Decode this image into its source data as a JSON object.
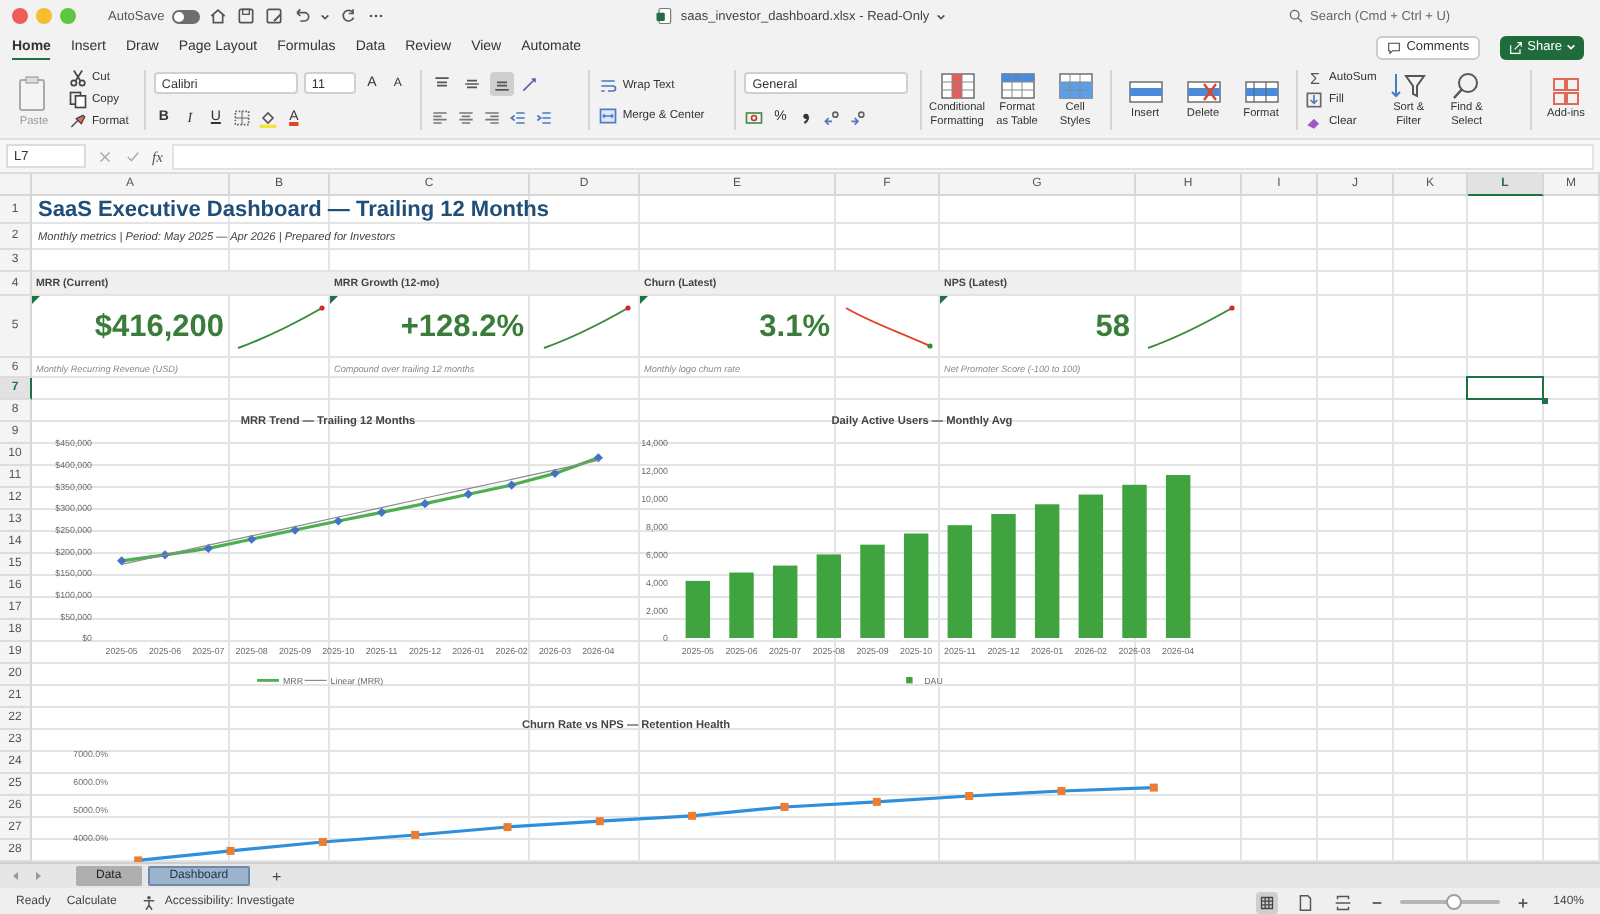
{
  "window": {
    "title": "saas_investor_dashboard.xlsx - Read-Only",
    "autosave_label": "AutoSave",
    "autosave_on": false,
    "search": {
      "placeholder": "Search (Cmd + Ctrl + U)"
    }
  },
  "ribbon_tabs": [
    {
      "label": "Home",
      "selected": true
    },
    {
      "label": "Insert",
      "selected": false
    },
    {
      "label": "Draw",
      "selected": false
    },
    {
      "label": "Page Layout",
      "selected": false
    },
    {
      "label": "Formulas",
      "selected": false
    },
    {
      "label": "Data",
      "selected": false
    },
    {
      "label": "Review",
      "selected": false
    },
    {
      "label": "View",
      "selected": false
    },
    {
      "label": "Automate",
      "selected": false
    }
  ],
  "comments_button": "Comments",
  "share_button": "Share",
  "ribbon": {
    "clipboard": {
      "paste": "Paste",
      "cut": "Cut",
      "copy": "Copy",
      "format": "Format"
    },
    "font": {
      "name": "Calibri",
      "size": "11",
      "grow": "A",
      "shrink": "A",
      "bold": "B",
      "italic": "I",
      "underline": "U",
      "tint": "A"
    },
    "vertical_align": [
      {
        "kind": "top",
        "selected": false
      },
      {
        "kind": "middle",
        "selected": false
      },
      {
        "kind": "bottom",
        "selected": true
      }
    ],
    "wrap_text": "Wrap Text",
    "merge": "Merge & Center",
    "number": {
      "format": "General",
      "percent": "%"
    },
    "styles": [
      {
        "kind": "conditional",
        "label": "Conditional\nFormatting"
      },
      {
        "kind": "table",
        "label": "Format\nas Table"
      },
      {
        "kind": "cell",
        "label": "Cell\nStyles"
      }
    ],
    "cells": [
      {
        "kind": "insert",
        "label": "Insert"
      },
      {
        "kind": "delete",
        "label": "Delete"
      },
      {
        "kind": "format",
        "label": "Format"
      }
    ],
    "editing": {
      "autosum_symbol": "Σ",
      "autosum": "AutoSum",
      "fill": "Fill",
      "clear": "Clear",
      "sort": "Sort &\nFilter",
      "find": "Find &\nSelect"
    },
    "add_ins": "Add-ins"
  },
  "formula_bar": {
    "name_box": "L7",
    "function_label": "fx"
  },
  "sheet": {
    "columns": [
      {
        "label": "A",
        "selected": false
      },
      {
        "label": "B",
        "selected": false
      },
      {
        "label": "C",
        "selected": false
      },
      {
        "label": "D",
        "selected": false
      },
      {
        "label": "E",
        "selected": false
      },
      {
        "label": "F",
        "selected": false
      },
      {
        "label": "G",
        "selected": false
      },
      {
        "label": "H",
        "selected": false
      },
      {
        "label": "I",
        "selected": false
      },
      {
        "label": "J",
        "selected": false
      },
      {
        "label": "K",
        "selected": false
      },
      {
        "label": "L",
        "selected": true
      },
      {
        "label": "M",
        "selected": false
      }
    ],
    "rows": [
      {
        "label": "1",
        "selected": false
      },
      {
        "label": "2",
        "selected": false
      },
      {
        "label": "3",
        "selected": false
      },
      {
        "label": "4",
        "selected": false
      },
      {
        "label": "5",
        "selected": false
      },
      {
        "label": "6",
        "selected": false
      },
      {
        "label": "7",
        "selected": true
      },
      {
        "label": "8",
        "selected": false
      },
      {
        "label": "9",
        "selected": false
      },
      {
        "label": "10",
        "selected": false
      },
      {
        "label": "11",
        "selected": false
      },
      {
        "label": "12",
        "selected": false
      },
      {
        "label": "13",
        "selected": false
      },
      {
        "label": "14",
        "selected": false
      },
      {
        "label": "15",
        "selected": false
      },
      {
        "label": "16",
        "selected": false
      },
      {
        "label": "17",
        "selected": false
      },
      {
        "label": "18",
        "selected": false
      },
      {
        "label": "19",
        "selected": false
      },
      {
        "label": "20",
        "selected": false
      },
      {
        "label": "21",
        "selected": false
      },
      {
        "label": "22",
        "selected": false
      },
      {
        "label": "23",
        "selected": false
      },
      {
        "label": "24",
        "selected": false
      },
      {
        "label": "25",
        "selected": false
      },
      {
        "label": "26",
        "selected": false
      },
      {
        "label": "27",
        "selected": false
      },
      {
        "label": "28",
        "selected": false
      }
    ],
    "title": "SaaS Executive Dashboard — Trailing 12 Months",
    "subtitle": "Monthly metrics | Period: May 2025 — Apr 2026 | Prepared for Investors",
    "kpis": [
      {
        "label": "MRR (Current)",
        "value": "$416,200",
        "caption": "Monthly Recurring Revenue (USD)",
        "falling": false
      },
      {
        "label": "MRR Growth (12-mo)",
        "value": "+128.2%",
        "caption": "Compound over trailing 12 months",
        "falling": false
      },
      {
        "label": "Churn (Latest)",
        "value": "3.1%",
        "caption": "Monthly logo churn rate",
        "falling": true
      },
      {
        "label": "NPS (Latest)",
        "value": "58",
        "caption": "Net Promoter Score (-100 to 100)",
        "falling": false
      }
    ]
  },
  "charts": [
    {
      "chart_data": {
        "type": "line",
        "title": "MRR Trend — Trailing 12 Months",
        "categories": [
          "2025-05",
          "2025-06",
          "2025-07",
          "2025-08",
          "2025-09",
          "2025-10",
          "2025-11",
          "2025-12",
          "2026-01",
          "2026-02",
          "2026-03",
          "2026-04"
        ],
        "ylim": [
          0,
          450000
        ],
        "yticks": [
          {
            "value": 0,
            "label": "$0"
          },
          {
            "value": 50000,
            "label": "$50,000"
          },
          {
            "value": 100000,
            "label": "$100,000"
          },
          {
            "value": 150000,
            "label": "$150,000"
          },
          {
            "value": 200000,
            "label": "$200,000"
          },
          {
            "value": 250000,
            "label": "$250,000"
          },
          {
            "value": 300000,
            "label": "$300,000"
          },
          {
            "value": 350000,
            "label": "$350,000"
          },
          {
            "value": 400000,
            "label": "$400,000"
          },
          {
            "value": 450000,
            "label": "$450,000"
          }
        ],
        "legend": true,
        "series": [
          {
            "name": "MRR",
            "color": "#4caf50",
            "marker": "diamond",
            "values": [
              178000,
              192000,
              207000,
              228000,
              249000,
              270000,
              290000,
              310000,
              332000,
              353000,
              380000,
              416000
            ]
          },
          {
            "name": "Linear (MRR)",
            "color": "#8c8c8c",
            "values": [
              170000,
              192000,
              214000,
              236000,
              257000,
              279000,
              301000,
              323000,
              345000,
              366000,
              388000,
              410000
            ]
          }
        ]
      }
    },
    {
      "chart_data": {
        "type": "bar",
        "title": "Daily Active Users — Monthly Avg",
        "categories": [
          "2025-05",
          "2025-06",
          "2025-07",
          "2025-08",
          "2025-09",
          "2025-10",
          "2025-11",
          "2025-12",
          "2026-01",
          "2026-02",
          "2026-03",
          "2026-04"
        ],
        "ylim": [
          0,
          14000
        ],
        "legend": true,
        "yticks": [
          {
            "value": 0,
            "label": "0"
          },
          {
            "value": 2000,
            "label": "2,000"
          },
          {
            "value": 4000,
            "label": "4,000"
          },
          {
            "value": 6000,
            "label": "6,000"
          },
          {
            "value": 8000,
            "label": "8,000"
          },
          {
            "value": 10000,
            "label": "10,000"
          },
          {
            "value": 12000,
            "label": "12,000"
          },
          {
            "value": 14000,
            "label": "14,000"
          }
        ],
        "series": [
          {
            "name": "DAU",
            "color": "#3fa33f",
            "values": [
              4100,
              4700,
              5200,
              6000,
              6700,
              7500,
              8100,
              8900,
              9600,
              10300,
              11000,
              11700
            ]
          }
        ]
      }
    }
  ],
  "retention_chart": {
    "title": "Churn Rate vs NPS — Retention Health",
    "axis_labels": [
      "7000.0%",
      "6000.0%",
      "5000.0%",
      "4000.0%"
    ]
  },
  "sheet_tabs": [
    {
      "label": "Data",
      "selected": false
    },
    {
      "label": "Dashboard",
      "selected": true
    }
  ],
  "add_sheet": "+",
  "status_bar": {
    "items": [
      "Ready",
      "Calculate"
    ],
    "accessibility": "Accessibility: Investigate",
    "zoom": "140%",
    "zoom_slider": {
      "level": 0.55
    }
  }
}
